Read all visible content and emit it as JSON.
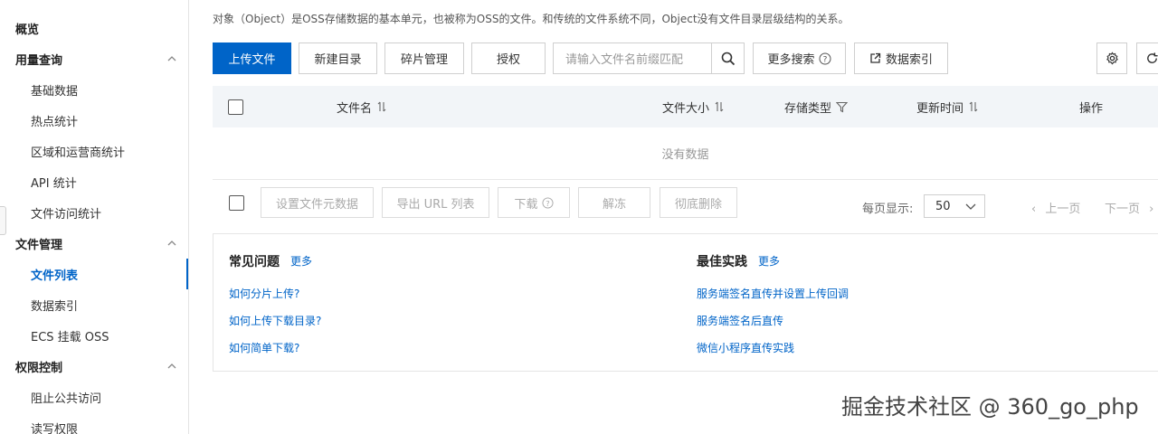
{
  "sidebar": {
    "items": [
      {
        "label": "概览",
        "type": "group"
      },
      {
        "label": "用量查询",
        "type": "group",
        "expanded": true
      },
      {
        "label": "基础数据",
        "type": "sub"
      },
      {
        "label": "热点统计",
        "type": "sub"
      },
      {
        "label": "区域和运营商统计",
        "type": "sub"
      },
      {
        "label": "API 统计",
        "type": "sub"
      },
      {
        "label": "文件访问统计",
        "type": "sub"
      },
      {
        "label": "文件管理",
        "type": "group",
        "expanded": true
      },
      {
        "label": "文件列表",
        "type": "sub",
        "active": true
      },
      {
        "label": "数据索引",
        "type": "sub"
      },
      {
        "label": "ECS 挂载 OSS",
        "type": "sub"
      },
      {
        "label": "权限控制",
        "type": "group",
        "expanded": true
      },
      {
        "label": "阻止公共访问",
        "type": "sub"
      },
      {
        "label": "读写权限",
        "type": "sub"
      }
    ]
  },
  "main": {
    "description": "对象（Object）是OSS存储数据的基本单元，也被称为OSS的文件。和传统的文件系统不同，Object没有文件目录层级结构的关系。",
    "toolbar": {
      "upload": "上传文件",
      "new_dir": "新建目录",
      "fragments": "碎片管理",
      "authorize": "授权",
      "search_placeholder": "请输入文件名前缀匹配",
      "more_search": "更多搜索",
      "data_index": "数据索引"
    },
    "table": {
      "columns": [
        "文件名",
        "文件大小",
        "存储类型",
        "更新时间",
        "操作"
      ],
      "empty_text": "没有数据"
    },
    "footer": {
      "set_meta": "设置文件元数据",
      "export_url": "导出 URL 列表",
      "download": "下载",
      "unfreeze": "解冻",
      "delete": "彻底删除",
      "per_page_label": "每页显示:",
      "per_page_value": "50",
      "prev": "上一页",
      "next": "下一页"
    },
    "faq": {
      "title": "常见问题",
      "more": "更多",
      "items": [
        "如何分片上传?",
        "如何上传下载目录?",
        "如何简单下载?"
      ]
    },
    "best": {
      "title": "最佳实践",
      "more": "更多",
      "items": [
        "服务端签名直传并设置上传回调",
        "服务端签名后直传",
        "微信小程序直传实践"
      ]
    }
  },
  "watermark": "掘金技术社区 @ 360_go_php",
  "colors": {
    "accent": "#0064c8",
    "header_bg": "#f2f5f8"
  }
}
